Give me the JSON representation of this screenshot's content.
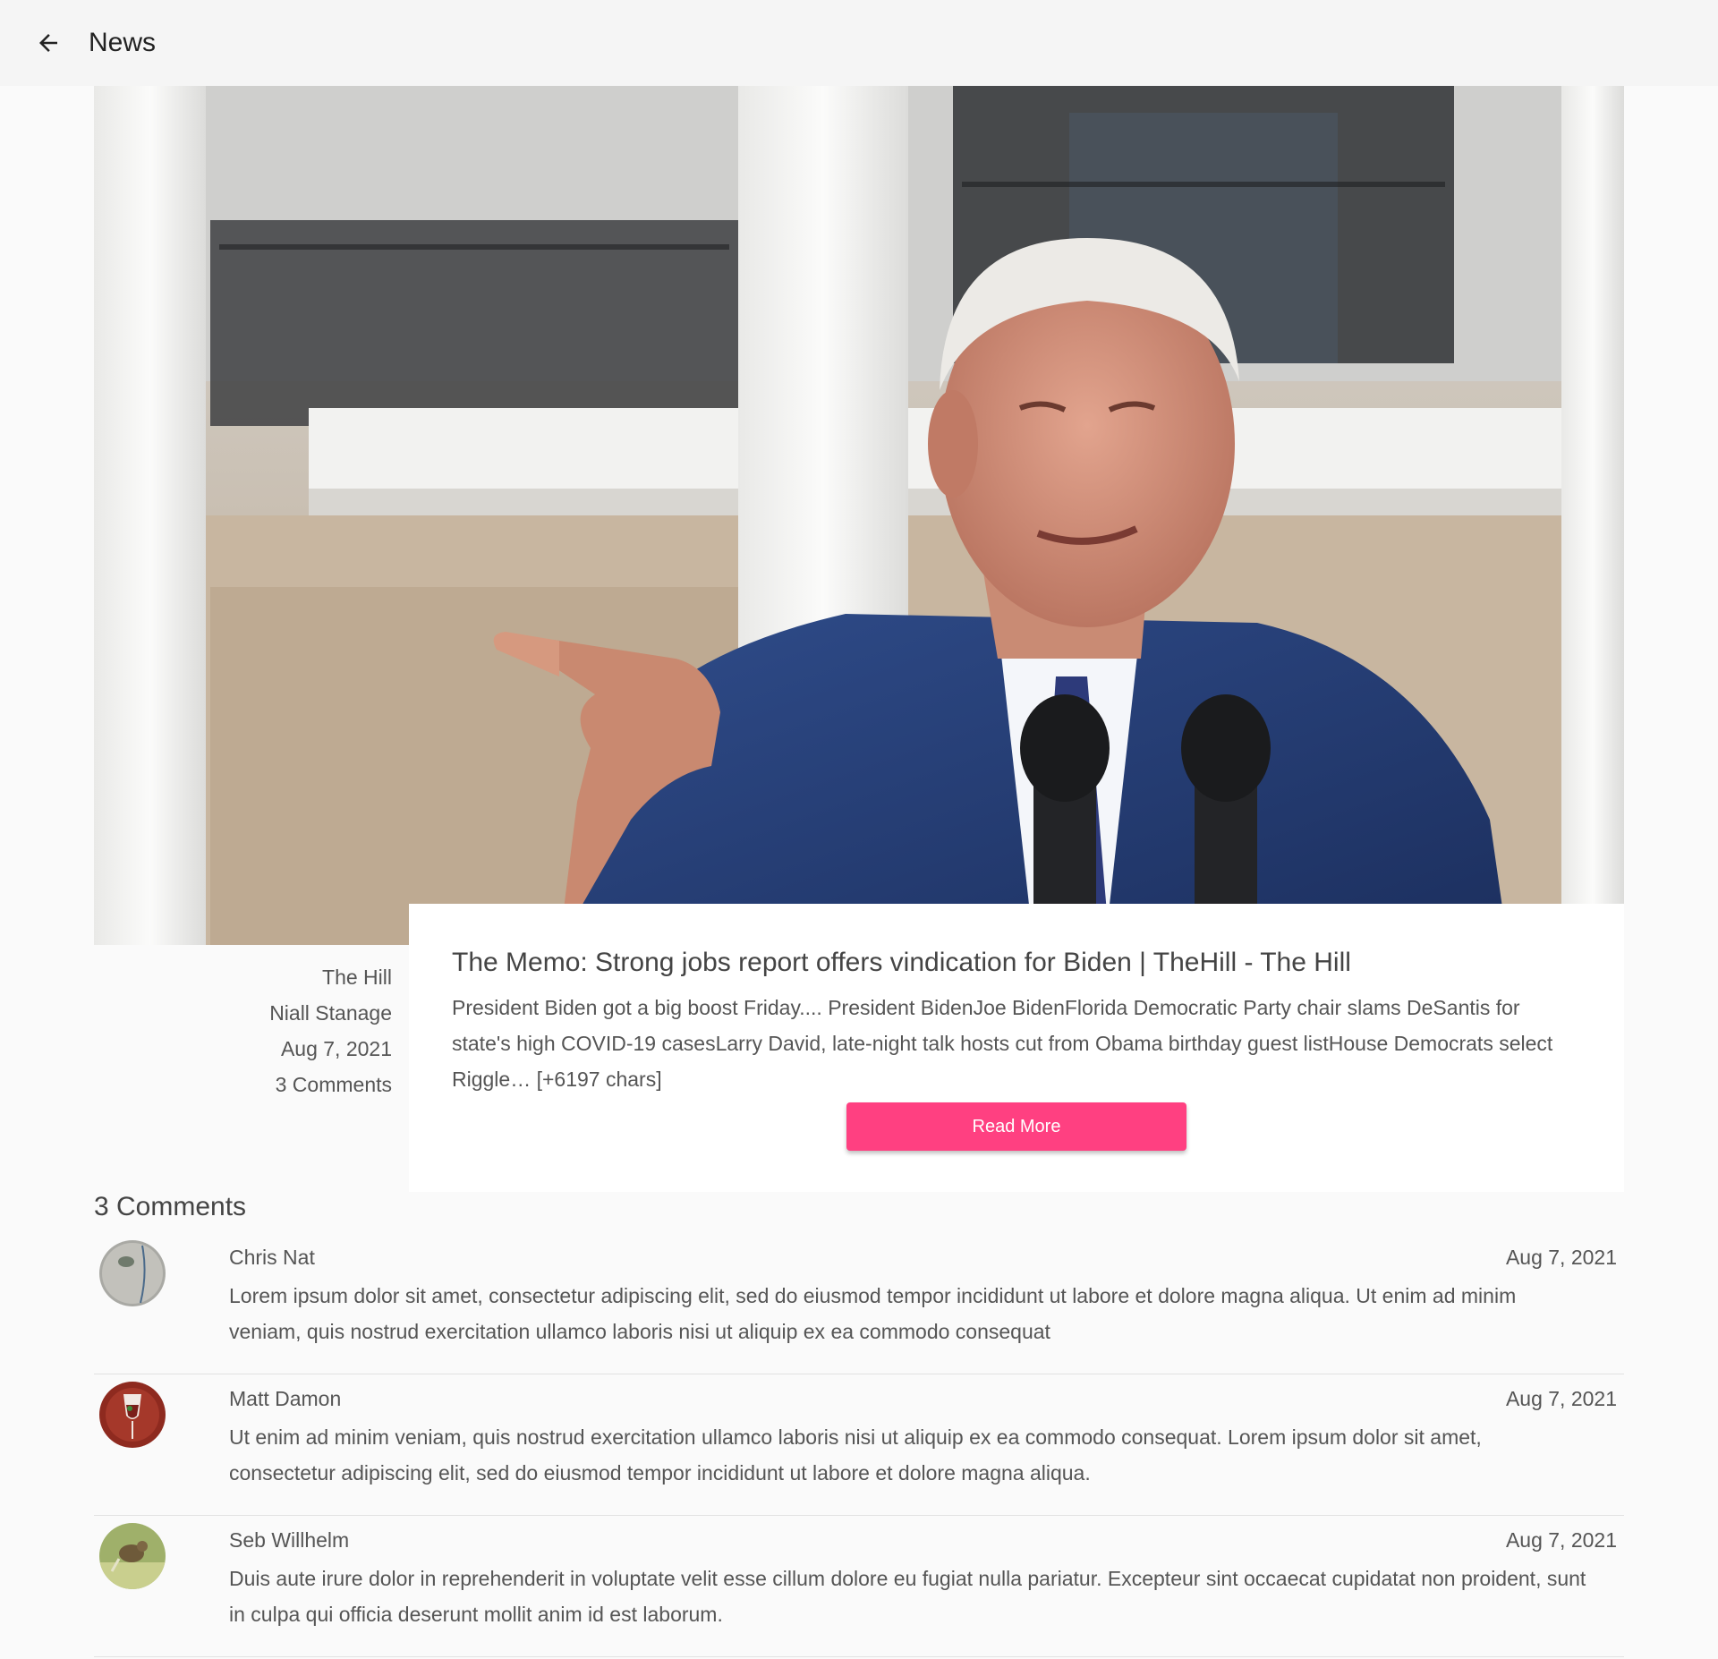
{
  "app_bar": {
    "title": "News",
    "back_icon": "arrow-left-icon"
  },
  "article": {
    "source": "The Hill",
    "author": "Niall Stanage",
    "date": "Aug 7, 2021",
    "comment_count_label": "3 Comments",
    "title": "The Memo: Strong jobs report offers vindication for Biden | TheHill - The Hill",
    "description": "President Biden got a big boost Friday.... President BidenJoe BidenFlorida Democratic Party chair slams DeSantis for state's high COVID-19 casesLarry David, late-night talk hosts cut from Obama birthday guest listHouse Democrats select Riggle… [+6197 chars]",
    "read_more_label": "Read More",
    "accent_color": "#ff4081"
  },
  "comments_section": {
    "heading": "3 Comments",
    "items": [
      {
        "name": "Chris Nat",
        "date": "Aug 7, 2021",
        "text": "Lorem ipsum dolor sit amet, consectetur adipiscing elit, sed do eiusmod tempor incididunt ut labore et dolore magna aliqua. Ut enim ad minim veniam, quis nostrud exercitation ullamco laboris nisi ut aliquip ex ea commodo consequat"
      },
      {
        "name": "Matt Damon",
        "date": "Aug 7, 2021",
        "text": "Ut enim ad minim veniam, quis nostrud exercitation ullamco laboris nisi ut aliquip ex ea commodo consequat. Lorem ipsum dolor sit amet, consectetur adipiscing elit, sed do eiusmod tempor incididunt ut labore et dolore magna aliqua."
      },
      {
        "name": "Seb Willhelm",
        "date": "Aug 7, 2021",
        "text": "Duis aute irure dolor in reprehenderit in voluptate velit esse cillum dolore eu fugiat nulla pariatur. Excepteur sint occaecat cupidatat non proident, sunt in culpa qui officia deserunt mollit anim id est laborum."
      }
    ]
  }
}
